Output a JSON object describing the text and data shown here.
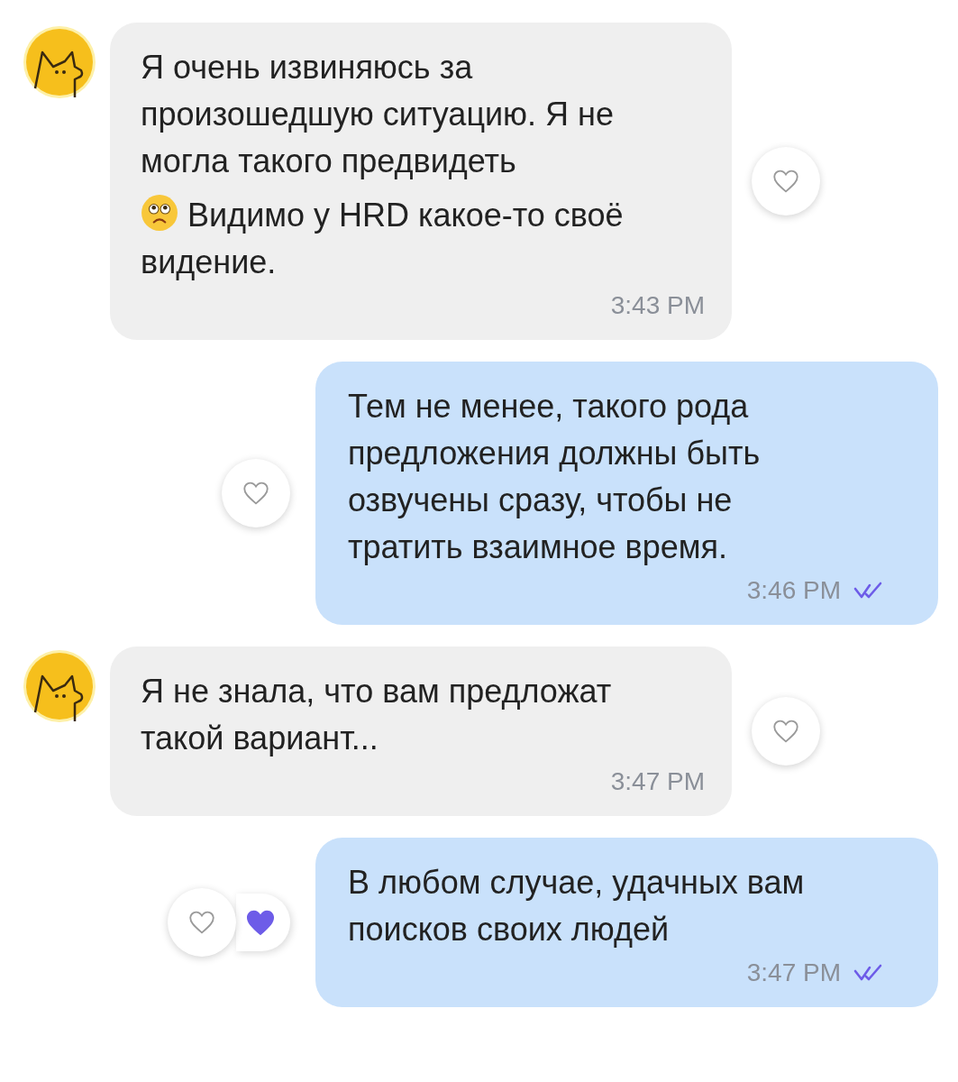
{
  "messages": [
    {
      "kind": "incoming",
      "parts": [
        "Я очень извиняюсь за произошедшую ситуацию. Я не могла такого предвидеть",
        "Видимо у HRD какое-то своё видение."
      ],
      "emoji": true,
      "time": "3:43 PM",
      "liked": false
    },
    {
      "kind": "outgoing",
      "parts": [
        "Тем не менее, такого рода предложения должны быть озвучены сразу, чтобы не тратить взаимное время."
      ],
      "time": "3:46 PM",
      "read": true,
      "liked": false
    },
    {
      "kind": "incoming",
      "parts": [
        "Я не знала, что вам предложат такой вариант..."
      ],
      "time": "3:47 PM",
      "liked": false
    },
    {
      "kind": "outgoing",
      "parts": [
        "В любом случае, удачных вам поисков своих людей"
      ],
      "time": "3:47 PM",
      "read": true,
      "liked": true
    }
  ]
}
